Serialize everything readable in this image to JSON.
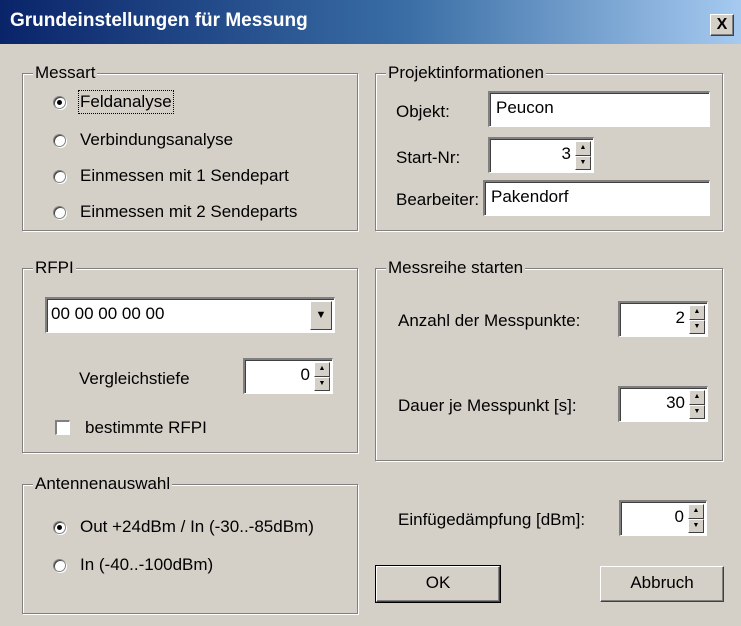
{
  "window": {
    "title": "Grundeinstellungen für Messung",
    "close_label": "X"
  },
  "messart": {
    "label": "Messart",
    "options": [
      {
        "label": "Feldanalyse",
        "checked": true
      },
      {
        "label": "Verbindungsanalyse",
        "checked": false
      },
      {
        "label": "Einmessen mit 1 Sendepart",
        "checked": false
      },
      {
        "label": "Einmessen mit 2 Sendeparts",
        "checked": false
      }
    ]
  },
  "projekt": {
    "label": "Projektinformationen",
    "objekt_label": "Objekt:",
    "objekt_value": "Peucon",
    "startnr_label": "Start-Nr:",
    "startnr_value": "3",
    "bearbeiter_label": "Bearbeiter:",
    "bearbeiter_value": "Pakendorf"
  },
  "rfpi": {
    "label": "RFPI",
    "value": "00 00 00 00 00",
    "vergleich_label": "Vergleichstiefe",
    "vergleich_value": "0",
    "bestimmte_label": "bestimmte RFPI",
    "bestimmte_checked": false
  },
  "messreihe": {
    "label": "Messreihe starten",
    "anzahl_label": "Anzahl der Messpunkte:",
    "anzahl_value": "2",
    "dauer_label": "Dauer je Messpunkt [s]:",
    "dauer_value": "30"
  },
  "antenne": {
    "label": "Antennenauswahl",
    "options": [
      {
        "label": "Out +24dBm / In (-30..-85dBm)",
        "checked": true
      },
      {
        "label": "In (-40..-100dBm)",
        "checked": false
      }
    ]
  },
  "einfuege": {
    "label": "Einfügedämpfung [dBm]:",
    "value": "0"
  },
  "buttons": {
    "ok": "OK",
    "abbruch": "Abbruch"
  }
}
